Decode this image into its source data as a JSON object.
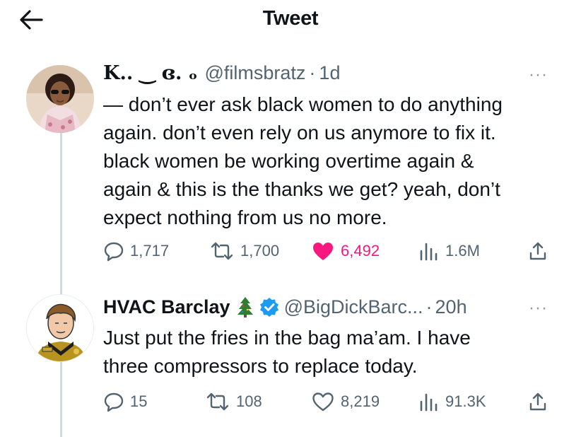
{
  "header": {
    "title": "Tweet"
  },
  "tweets": [
    {
      "display_name": "K.. ‿ ɞ. ₒ",
      "handle": "@filmsbratz",
      "separator": "·",
      "time": "1d",
      "more": "···",
      "lines": [
        "— don’t ever ask black women to do anything",
        "again. don’t even rely on us anymore to fix it.",
        "black women be working overtime again &",
        "again & this is the thanks we get? yeah, don’t",
        "expect nothing from us no more."
      ],
      "actions": {
        "replies": "1,717",
        "retweets": "1,700",
        "likes": "6,492",
        "views": "1.6M"
      },
      "liked": true
    },
    {
      "display_name": "HVAC Barclay",
      "handle": "@BigDickBarc...",
      "separator": "·",
      "time": "20h",
      "more": "···",
      "lines": [
        "Just put the fries in the bag ma’am. I have",
        "three compressors to replace today."
      ],
      "actions": {
        "replies": "15",
        "retweets": "108",
        "likes": "8,219",
        "views": "91.3K"
      },
      "liked": false
    }
  ],
  "colors": {
    "accent": "#1d9bf0",
    "like": "#f91880",
    "muted": "#536471"
  }
}
